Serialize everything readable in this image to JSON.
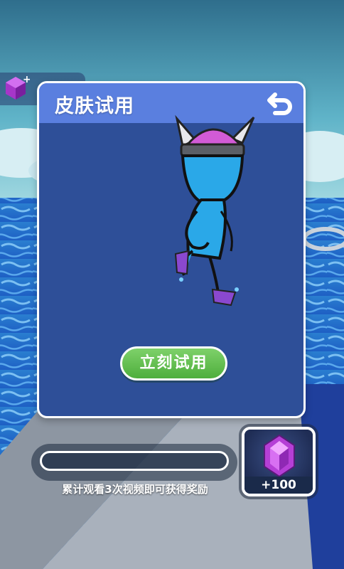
{
  "panel": {
    "title": "皮肤试用",
    "try_button_label": "立刻试用"
  },
  "video_progress": {
    "fraction": 0,
    "text": "累计观看3次视频即可获得奖励"
  },
  "reward": {
    "amount": "+100",
    "icon": "purple-gem-icon"
  },
  "top_gem_counter": {
    "icon": "purple-gem-icon"
  },
  "colors": {
    "panel_bg": "#2e4f98",
    "panel_header": "#5a7fdf",
    "button_green": "#5cbc48",
    "gem_purple": "#b53fd6",
    "character_blue": "#2aa8e8"
  }
}
